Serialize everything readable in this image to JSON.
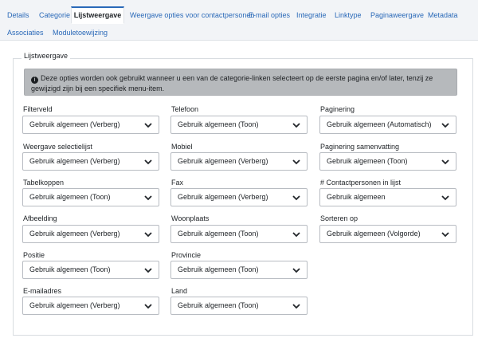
{
  "tabs": [
    {
      "label": "Details"
    },
    {
      "label": "Categorie"
    },
    {
      "label": "Lijstweergave"
    },
    {
      "label": "Weergave opties voor contactpersonen"
    },
    {
      "label": "E-mail opties"
    },
    {
      "label": "Integratie"
    },
    {
      "label": "Linktype"
    },
    {
      "label": "Paginaweergave"
    },
    {
      "label": "Metadata"
    },
    {
      "label": "Associaties"
    },
    {
      "label": "Moduletoewijzing"
    }
  ],
  "active_tab": "Lijstweergave",
  "fieldset": {
    "legend": "Lijstweergave",
    "info": "Deze opties worden ook gebruikt wanneer u een van de categorie-linken selecteert op de eerste pagina en/of later, tenzij ze gewijzigd zijn bij een specifiek menu-item.",
    "info_icon": "info-circle-icon"
  },
  "fields": [
    {
      "label": "Filterveld",
      "value": "Gebruik algemeen (Verberg)"
    },
    {
      "label": "Telefoon",
      "value": "Gebruik algemeen (Toon)"
    },
    {
      "label": "Paginering",
      "value": "Gebruik algemeen (Automatisch)"
    },
    {
      "label": "Weergave selectielijst",
      "value": "Gebruik algemeen (Verberg)"
    },
    {
      "label": "Mobiel",
      "value": "Gebruik algemeen (Verberg)"
    },
    {
      "label": "Paginering samenvatting",
      "value": "Gebruik algemeen (Toon)"
    },
    {
      "label": "Tabelkoppen",
      "value": "Gebruik algemeen (Toon)"
    },
    {
      "label": "Fax",
      "value": "Gebruik algemeen (Verberg)"
    },
    {
      "label": "# Contactpersonen in lijst",
      "value": "Gebruik algemeen"
    },
    {
      "label": "Afbeelding",
      "value": "Gebruik algemeen (Verberg)"
    },
    {
      "label": "Woonplaats",
      "value": "Gebruik algemeen (Toon)"
    },
    {
      "label": "Sorteren op",
      "value": "Gebruik algemeen (Volgorde)"
    },
    {
      "label": "Positie",
      "value": "Gebruik algemeen (Toon)"
    },
    {
      "label": "Provincie",
      "value": "Gebruik algemeen (Toon)"
    },
    {
      "label": "E-mailadres",
      "value": "Gebruik algemeen (Verberg)"
    },
    {
      "label": "Land",
      "value": "Gebruik algemeen (Toon)"
    }
  ],
  "colors": {
    "link": "#2a69b8",
    "info_bg": "#b6b9bc",
    "border": "#b8bcc2"
  }
}
